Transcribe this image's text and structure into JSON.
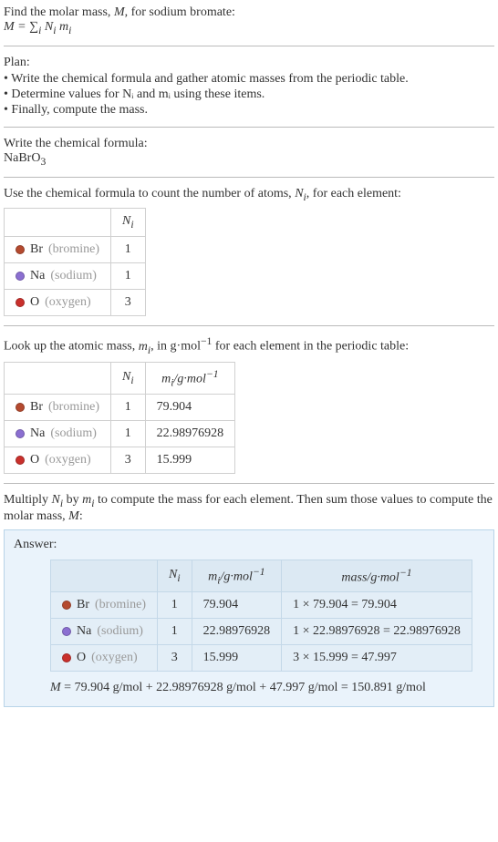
{
  "intro": {
    "line1_prefix": "Find the molar mass, ",
    "line1_m": "M",
    "line1_suffix": ", for sodium bromate:",
    "formula_html": "M = ∑<sub>i</sub> N<sub>i</sub> m<sub>i</sub>"
  },
  "plan": {
    "title": "Plan:",
    "items": [
      "• Write the chemical formula and gather atomic masses from the periodic table.",
      "• Determine values for Nᵢ and mᵢ using these items.",
      "• Finally, compute the mass."
    ]
  },
  "chemformula": {
    "title": "Write the chemical formula:",
    "value_html": "NaBrO<sub>3</sub>"
  },
  "count": {
    "title_html": "Use the chemical formula to count the number of atoms, <span class=\"italic\">N<sub>i</sub></span>, for each element:",
    "header_ni_html": "N<sub>i</sub>",
    "rows": [
      {
        "color": "#b44a2f",
        "sym": "Br",
        "name": "(bromine)",
        "n": "1"
      },
      {
        "color": "#8b6fd1",
        "sym": "Na",
        "name": "(sodium)",
        "n": "1"
      },
      {
        "color": "#c9302c",
        "sym": "O",
        "name": "(oxygen)",
        "n": "3"
      }
    ]
  },
  "mass": {
    "title_html": "Look up the atomic mass, <span class=\"italic\">m<sub>i</sub></span>, in g·mol<sup>−1</sup> for each element in the periodic table:",
    "header_ni_html": "N<sub>i</sub>",
    "header_mi_html": "m<sub>i</sub>/g·mol<sup>−1</sup>",
    "rows": [
      {
        "color": "#b44a2f",
        "sym": "Br",
        "name": "(bromine)",
        "n": "1",
        "m": "79.904"
      },
      {
        "color": "#8b6fd1",
        "sym": "Na",
        "name": "(sodium)",
        "n": "1",
        "m": "22.98976928"
      },
      {
        "color": "#c9302c",
        "sym": "O",
        "name": "(oxygen)",
        "n": "3",
        "m": "15.999"
      }
    ]
  },
  "compute": {
    "title_html": "Multiply <span class=\"italic\">N<sub>i</sub></span> by <span class=\"italic\">m<sub>i</sub></span> to compute the mass for each element. Then sum those values to compute the molar mass, <span class=\"italic\">M</span>:"
  },
  "answer": {
    "label": "Answer:",
    "header_ni_html": "N<sub>i</sub>",
    "header_mi_html": "m<sub>i</sub>/g·mol<sup>−1</sup>",
    "header_mass_html": "mass/g·mol<sup>−1</sup>",
    "rows": [
      {
        "color": "#b44a2f",
        "sym": "Br",
        "name": "(bromine)",
        "n": "1",
        "m": "79.904",
        "mass": "1 × 79.904 = 79.904"
      },
      {
        "color": "#8b6fd1",
        "sym": "Na",
        "name": "(sodium)",
        "n": "1",
        "m": "22.98976928",
        "mass": "1 × 22.98976928 = 22.98976928"
      },
      {
        "color": "#c9302c",
        "sym": "O",
        "name": "(oxygen)",
        "n": "3",
        "m": "15.999",
        "mass": "3 × 15.999 = 47.997"
      }
    ],
    "final_html": "<span class=\"italic\">M</span> = 79.904 g/mol + 22.98976928 g/mol + 47.997 g/mol = 150.891 g/mol"
  }
}
